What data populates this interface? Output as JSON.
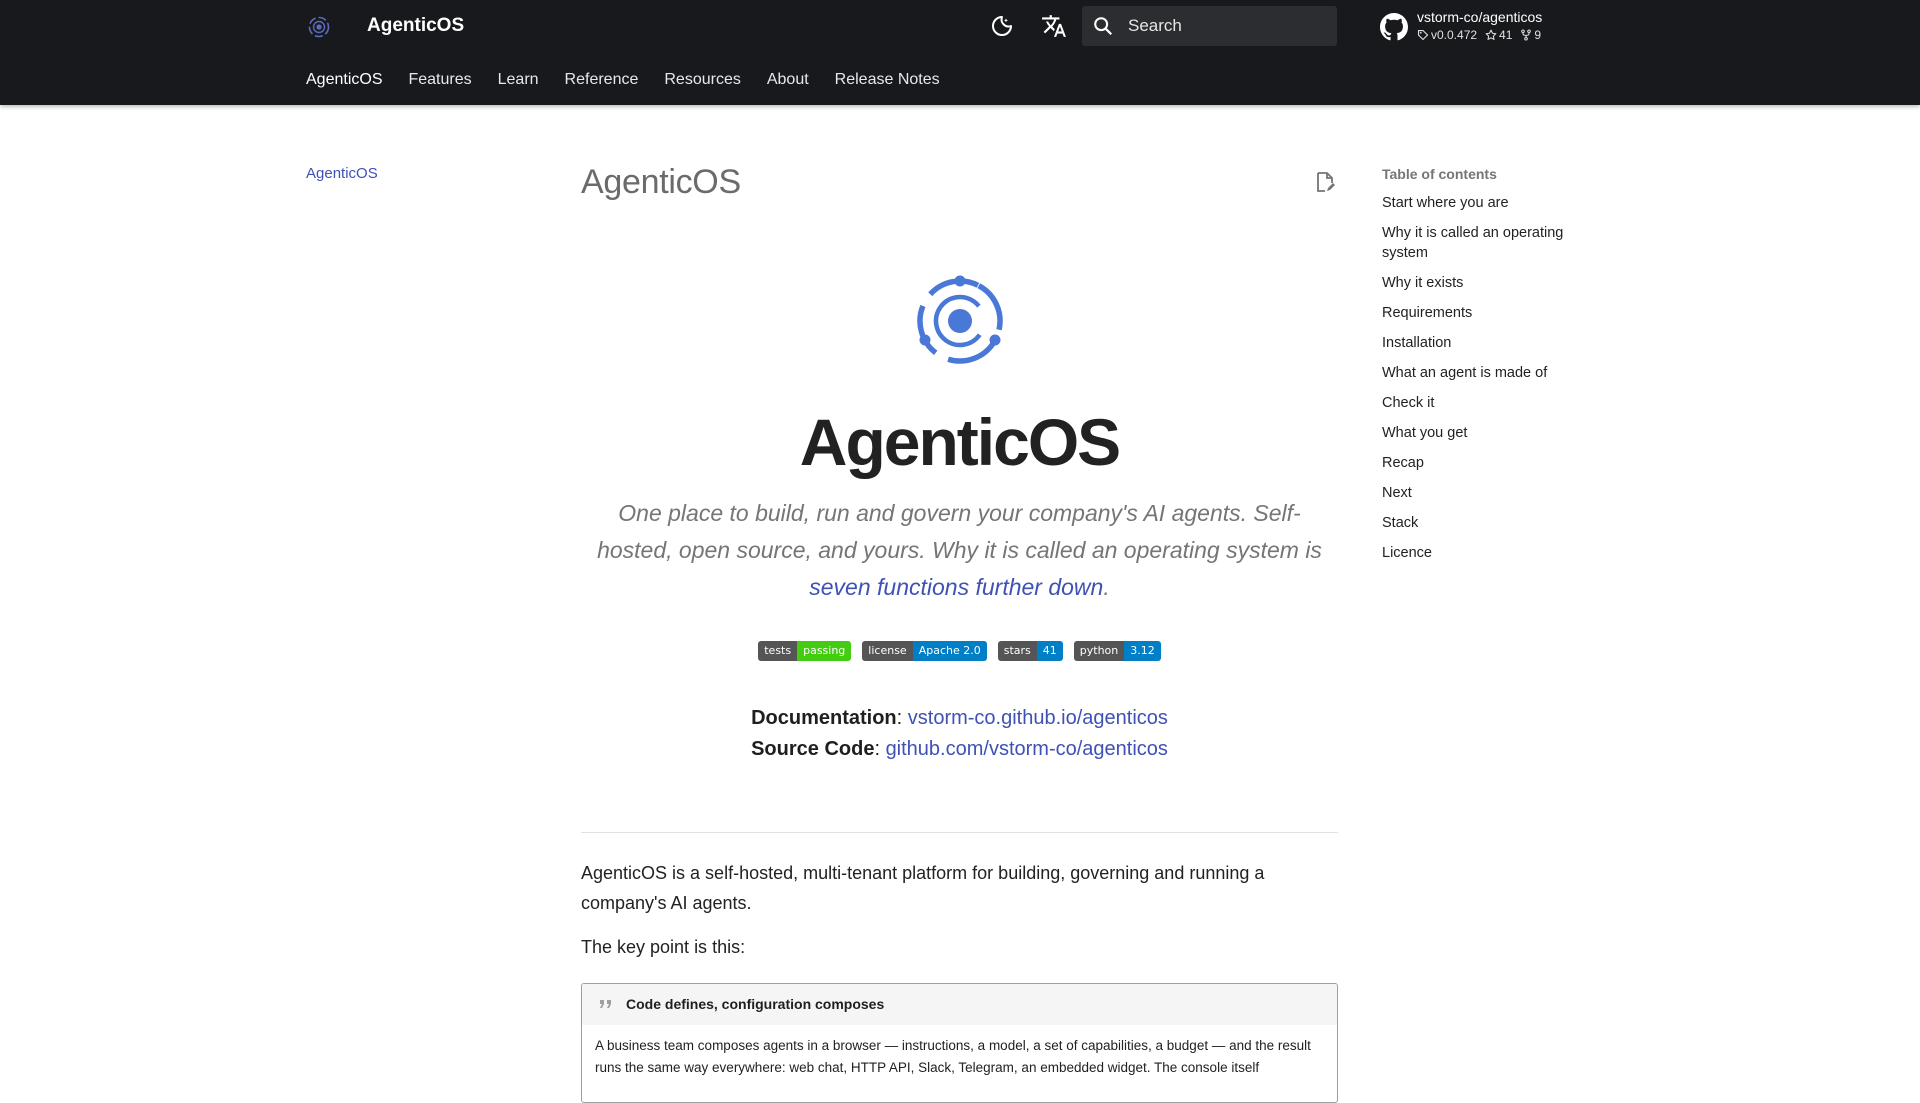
{
  "header": {
    "site_title": "AgenticOS",
    "search_placeholder": "Search",
    "repo": {
      "name": "vstorm-co/agenticos",
      "version": "v0.0.472",
      "stars": "41",
      "forks": "9"
    },
    "tabs": [
      {
        "label": "AgenticOS"
      },
      {
        "label": "Features"
      },
      {
        "label": "Learn"
      },
      {
        "label": "Reference"
      },
      {
        "label": "Resources"
      },
      {
        "label": "About"
      },
      {
        "label": "Release Notes"
      }
    ],
    "colors": {
      "background": "#18191c",
      "accent": "#3f51b5"
    },
    "icons": [
      "logo-icon",
      "dark-mode-icon",
      "translate-icon",
      "search-icon",
      "github-icon",
      "tag-icon",
      "star-icon",
      "fork-icon"
    ]
  },
  "left_nav": {
    "items": [
      {
        "label": "AgenticOS"
      }
    ]
  },
  "main": {
    "page_title": "AgenticOS",
    "hero_title": "AgenticOS",
    "tagline": {
      "text": "One place to build, run and govern your company's AI agents. Self-hosted, open source, and yours. Why it is called an operating system is ",
      "link": "seven functions further down",
      "end": "."
    },
    "badges": [
      {
        "label": "tests",
        "value": "passing",
        "color": "#4c1"
      },
      {
        "label": "license",
        "value": "Apache 2.0",
        "color": "#007ec6"
      },
      {
        "label": "stars",
        "value": "41",
        "color": "#007ec6"
      },
      {
        "label": "python",
        "value": "3.12",
        "color": "#007ec6"
      }
    ],
    "documentation": {
      "label": "Documentation",
      "sep": ": ",
      "url": "vstorm-co.github.io/agenticos"
    },
    "source_code": {
      "label": "Source Code",
      "sep": ": ",
      "url": "github.com/vstorm-co/agenticos"
    },
    "intro": "AgenticOS is a self-hosted, multi-tenant platform for building, governing and running a company's AI agents.",
    "key_point": "The key point is this:",
    "admonition": {
      "title": "Code defines, configuration composes",
      "body": "A business team composes agents in a browser — instructions, a model, a set of capabilities, a budget — and the result runs the same way everywhere: web chat, HTTP API, Slack, Telegram, an embedded widget. The console itself"
    }
  },
  "toc": {
    "title": "Table of contents",
    "items": [
      {
        "label": "Start where you are"
      },
      {
        "label": "Why it is called an operating system"
      },
      {
        "label": "Why it exists"
      },
      {
        "label": "Requirements"
      },
      {
        "label": "Installation"
      },
      {
        "label": "What an agent is made of"
      },
      {
        "label": "Check it"
      },
      {
        "label": "What you get"
      },
      {
        "label": "Recap"
      },
      {
        "label": "Next"
      },
      {
        "label": "Stack"
      },
      {
        "label": "Licence"
      }
    ]
  }
}
